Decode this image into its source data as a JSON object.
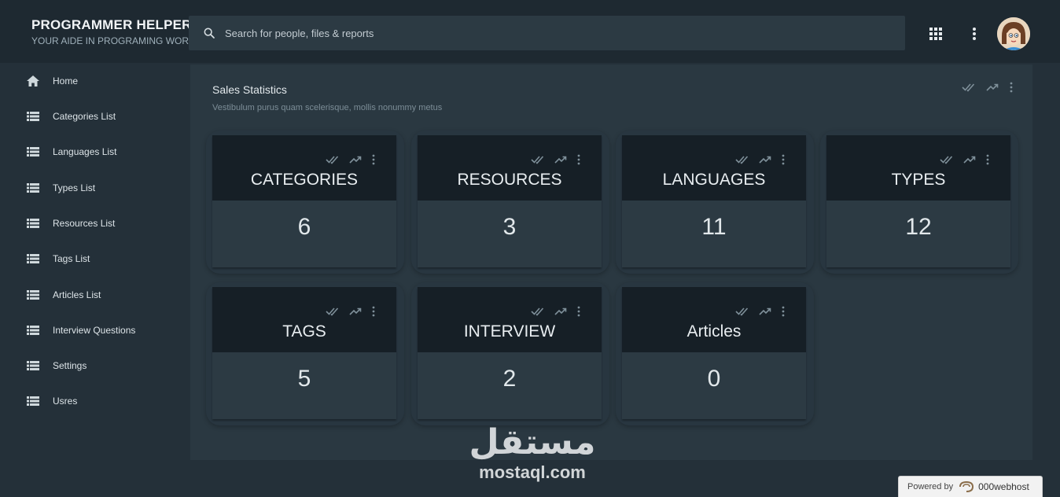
{
  "header": {
    "brand_title": "PROGRAMMER HELPER",
    "brand_subtitle": "YOUR AIDE IN PROGRAMING WORLD",
    "search_placeholder": "Search for people, files & reports",
    "icons": [
      "search-icon",
      "apps-grid-icon",
      "more-vert-icon",
      "avatar"
    ]
  },
  "sidebar": {
    "items": [
      {
        "label": "Home",
        "icon": "home-icon"
      },
      {
        "label": "Categories List",
        "icon": "list-icon"
      },
      {
        "label": "Languages List",
        "icon": "list-icon"
      },
      {
        "label": "Types List",
        "icon": "list-icon"
      },
      {
        "label": "Resources List",
        "icon": "list-icon"
      },
      {
        "label": "Tags List",
        "icon": "list-icon"
      },
      {
        "label": "Articles List",
        "icon": "list-icon"
      },
      {
        "label": "Interview Questions",
        "icon": "list-icon"
      },
      {
        "label": "Settings",
        "icon": "list-icon"
      },
      {
        "label": "Usres",
        "icon": "list-icon"
      }
    ]
  },
  "panel": {
    "title": "Sales Statistics",
    "subtitle": "Vestibulum purus quam scelerisque, mollis nonummy metus"
  },
  "cards": [
    {
      "title": "CATEGORIES",
      "value": "6"
    },
    {
      "title": "RESOURCES",
      "value": "3"
    },
    {
      "title": "LANGUAGES",
      "value": "11"
    },
    {
      "title": "TYPES",
      "value": "12"
    },
    {
      "title": "TAGS",
      "value": "5"
    },
    {
      "title": "INTERVIEW",
      "value": "2"
    },
    {
      "title": "Articles",
      "value": "0"
    }
  ],
  "watermark": {
    "arabic": "مستقل",
    "latin": "mostaql.com"
  },
  "footer_badge": {
    "powered_by": "Powered by",
    "host": "000webhost"
  },
  "colors": {
    "background": "#243039",
    "topbar": "#1e2931",
    "panel": "#2a3841",
    "card_head": "#161f26"
  }
}
